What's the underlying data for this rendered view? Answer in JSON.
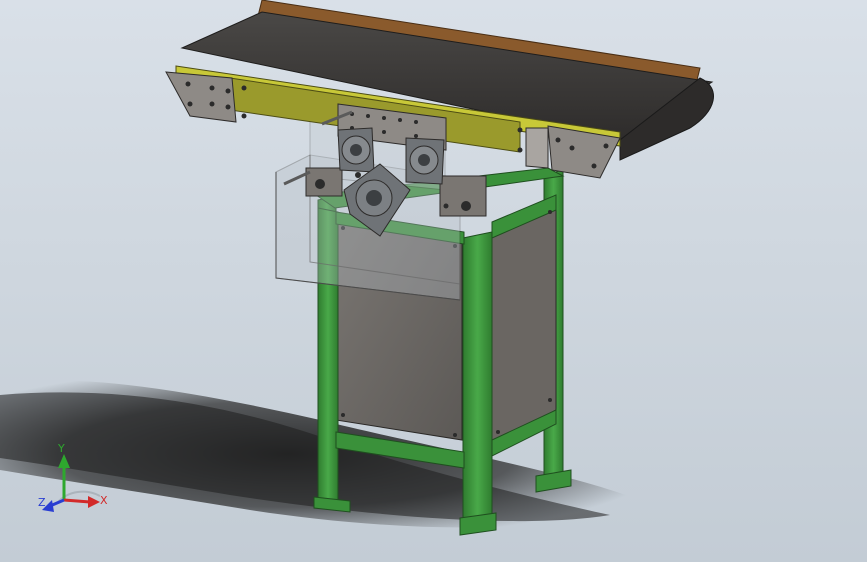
{
  "viewport": {
    "background_top": "#d9e0e8",
    "background_bottom": "#c3ccd5"
  },
  "model": {
    "frame_color": "#3f9a3f",
    "panel_color": "#6e6a66",
    "belt_color": "#3c3a38",
    "side_rail_color": "#9a9a2c",
    "side_guide_color": "#8a5a2c",
    "bracket_color": "#8e8a86",
    "bearing_color": "#6f7377"
  },
  "triad": {
    "x_label": "X",
    "y_label": "Y",
    "z_label": "Z",
    "x_color": "#d22a2a",
    "y_color": "#2ea82e",
    "z_color": "#2a3ed2"
  }
}
